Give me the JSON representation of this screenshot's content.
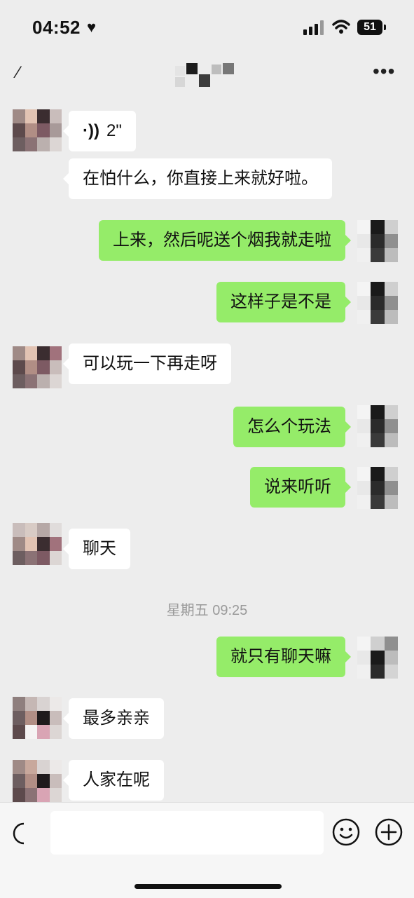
{
  "status_bar": {
    "time": "04:52",
    "battery": "51"
  },
  "nav": {
    "back_glyph": "⁄",
    "more_glyph": "•••"
  },
  "messages": [
    {
      "kind": "voice",
      "duration": "2\""
    },
    {
      "text": "在怕什么，你直接上来就好啦。"
    },
    {
      "text": "上来，然后呢送个烟我就走啦"
    },
    {
      "text": "这样子是不是"
    },
    {
      "text": "可以玩一下再走呀"
    },
    {
      "text": "怎么个玩法"
    },
    {
      "text": "说来听听"
    },
    {
      "text": "聊天"
    },
    {
      "text": "就只有聊天嘛"
    },
    {
      "text": "最多亲亲"
    },
    {
      "text": "人家在呢"
    }
  ],
  "timestamp": "星期五 09:25",
  "colors": {
    "outgoing_bubble": "#95ec69",
    "incoming_bubble": "#ffffff",
    "background": "#ededed"
  },
  "icons": {
    "voice": "voice-wave-icon",
    "emoji": "smiley-icon",
    "plus": "plus-circle-icon"
  }
}
